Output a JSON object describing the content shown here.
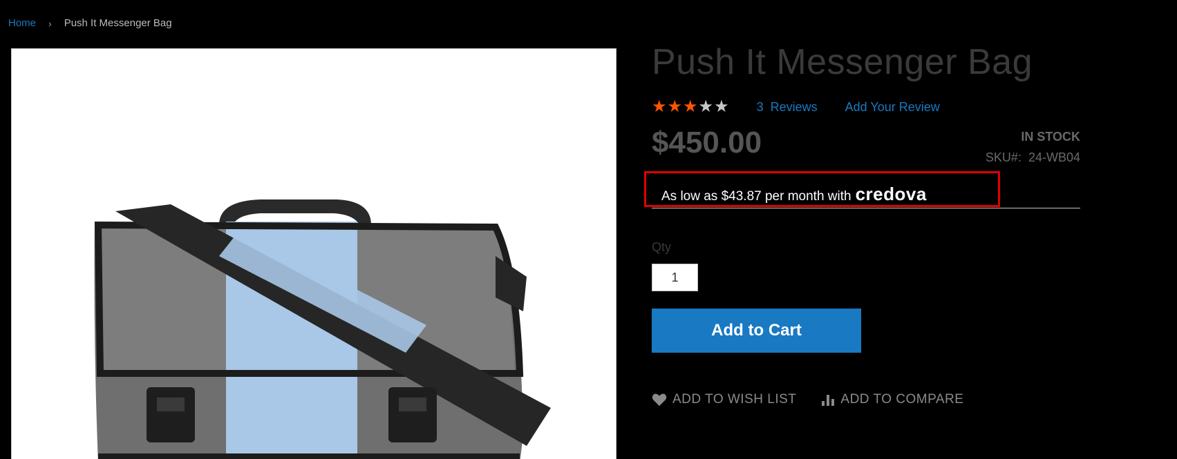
{
  "breadcrumb": {
    "home": "Home",
    "current": "Push It Messenger Bag"
  },
  "product": {
    "title": "Push It Messenger Bag",
    "rating": 3.5,
    "reviews_count": "3",
    "reviews_label": "Reviews",
    "add_review": "Add Your Review",
    "price": "$450.00",
    "stock": "IN STOCK",
    "sku_label": "SKU#:",
    "sku": "24-WB04"
  },
  "financing": {
    "text": "As low as $43.87 per month with",
    "brand": "credova"
  },
  "purchase": {
    "qty_label": "Qty",
    "qty_value": "1",
    "add_to_cart": "Add to Cart"
  },
  "actions": {
    "wishlist": "ADD TO WISH LIST",
    "compare": "ADD TO COMPARE"
  },
  "colors": {
    "accent": "#1979c3",
    "star": "#ff5501",
    "highlight": "#e00000"
  }
}
